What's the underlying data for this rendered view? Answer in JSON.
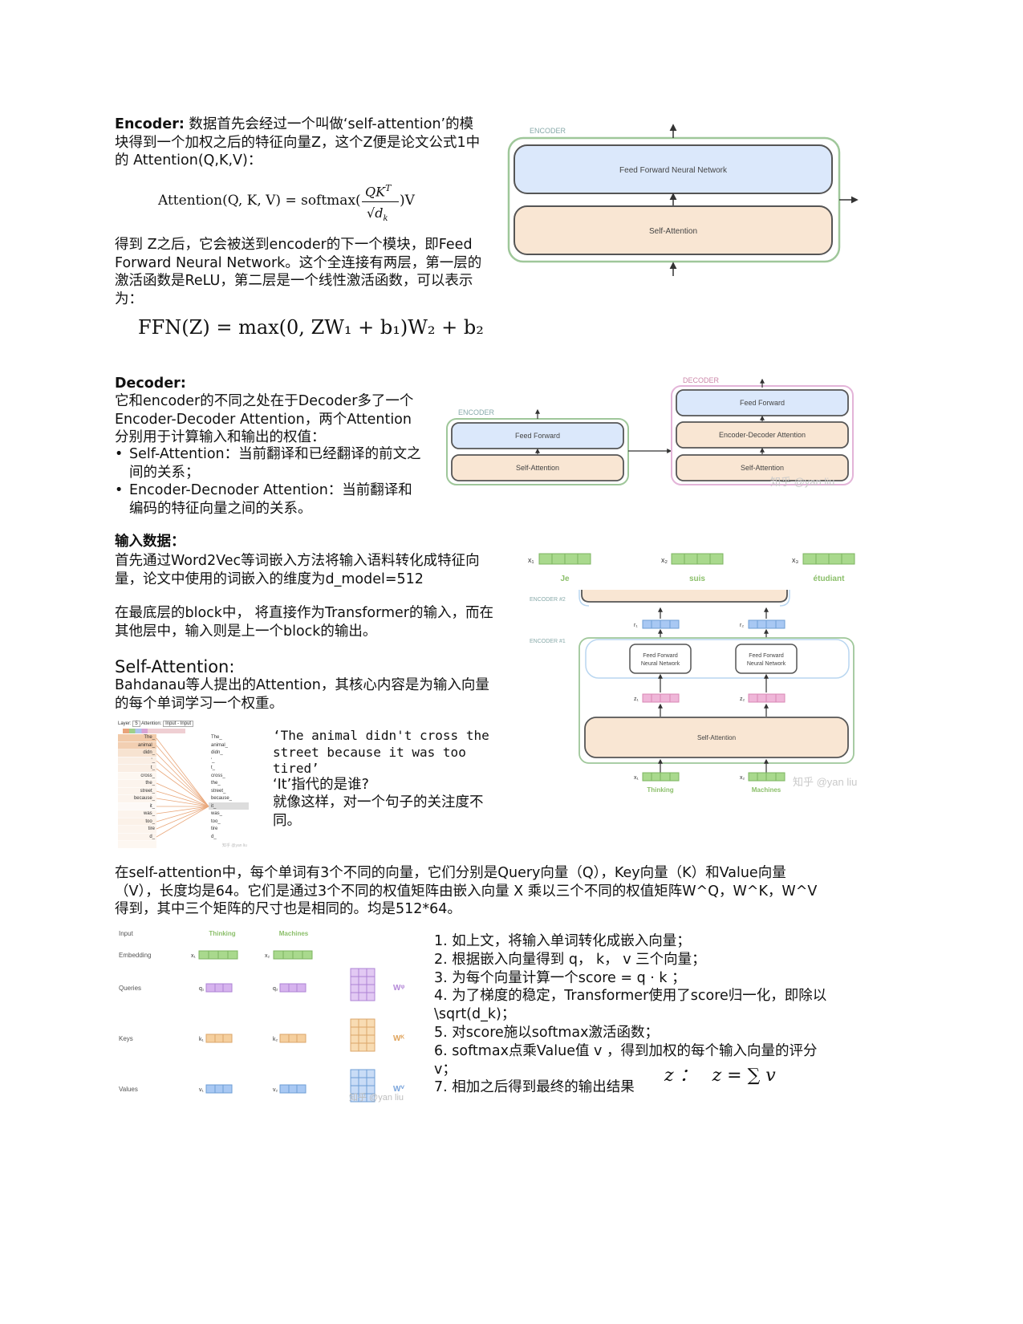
{
  "encoder": {
    "heading": "Encoder:",
    "intro": " 数据首先会经过一个叫做‘self-attention’的模块得到一个加权之后的特征向量Z，这个Z便是论文公式1中的 Attention(Q,K,V)：",
    "formula_lhs": "Attention(Q, K, V) = softmax(",
    "formula_num": "QK",
    "formula_sup": "T",
    "formula_den": "√d",
    "formula_den_sub": "k",
    "formula_rhs": ")V",
    "ffn_text": "得到 Z之后，它会被送到encoder的下一个模块，即Feed Forward Neural Network。这个全连接有两层，第一层的激活函数是ReLU，第二层是一个线性激活函数，可以表示为：",
    "ffn_formula": "FFN(Z) = max(0, ZW₁ + b₁)W₂ + b₂",
    "diagram": {
      "label": "ENCODER",
      "ffnn": "Feed Forward Neural Network",
      "self_attention": "Self-Attention"
    }
  },
  "decoder": {
    "heading": "Decoder:",
    "text": "它和encoder的不同之处在于Decoder多了一个Encoder-Decoder Attention，两个Attention分别用于计算输入和输出的权值：",
    "bullets": [
      "Self-Attention：当前翻译和已经翻译的前文之间的关系；",
      "Encoder-Decnoder Attention：当前翻译和编码的特征向量之间的关系。"
    ],
    "diagram": {
      "encoder_label": "ENCODER",
      "decoder_label": "DECODER",
      "feed_forward": "Feed Forward",
      "self_attention": "Self-Attention",
      "enc_dec_attention": "Encoder-Decoder Attention",
      "watermark": "知乎 @yan liu"
    }
  },
  "input": {
    "heading": "输入数据：",
    "p1": "首先通过Word2Vec等词嵌入方法将输入语料转化成特征向量，论文中使用的词嵌入的维度为d_model=512",
    "p2": "在最底层的block中，  将直接作为Transformer的输入，而在其他层中，输入则是上一个block的输出。",
    "diagram": {
      "x1": "x₁",
      "x2": "x₂",
      "x3": "x₃",
      "w1": "Je",
      "w2": "suis",
      "w3": "étudiant",
      "enc2": "ENCODER #2",
      "enc1": "ENCODER #1",
      "r1": "r₁",
      "r2": "r₂",
      "z1": "z₁",
      "z2": "z₂",
      "ffnn_line1": "Feed Forward",
      "ffnn_line2": "Neural Network",
      "self_attention": "Self-Attention",
      "bx1": "x₁",
      "bx2": "x₂",
      "thinking": "Thinking",
      "machines": "Machines",
      "watermark": "知乎 @yan liu"
    }
  },
  "selfattn": {
    "heading": "Self-Attention:",
    "text": "Bahdanau等人提出的Attention，其核心内容是为输入向量的每个单词学习一个权重。",
    "quote": "‘The animal didn't cross the street because it was too tired’",
    "q2": "‘It’指代的是谁?",
    "q3": "就像这样，对一个句子的关注度不同。",
    "viz": {
      "layer_label": "Layer:",
      "layer_value": "5",
      "attn_label": "Attention:",
      "attn_value": "Input - Input",
      "tokens": [
        "The_",
        "animal_",
        "didn_",
        "'_",
        "t_",
        "cross_",
        "the_",
        "street_",
        "because_",
        "it_",
        "was_",
        "too_",
        "tire",
        "d_"
      ],
      "footer": "知乎 @yan liu"
    }
  },
  "qkv": {
    "paragraph": "在self-attention中，每个单词有3个不同的向量，它们分别是Query向量（Q），Key向量（K）和Value向量（V），长度均是64。它们是通过3个不同的权值矩阵由嵌入向量 X 乘以三个不同的权值矩阵W^Q，W^K，W^V 得到，其中三个矩阵的尺寸也是相同的。均是512*64。",
    "diagram": {
      "input": "Input",
      "thinking": "Thinking",
      "machines": "Machines",
      "embedding": "Embedding",
      "queries": "Queries",
      "keys": "Keys",
      "values": "Values",
      "x1": "x₁",
      "x2": "x₂",
      "q1": "q₁",
      "q2": "q₂",
      "k1": "k₁",
      "k2": "k₂",
      "v1": "v₁",
      "v2": "v₂",
      "wq": "Wᵠ",
      "wk": "Wᴷ",
      "wv": "Wⱽ",
      "watermark": "知乎 @yan liu"
    },
    "steps": [
      "1.   如上文，将输入单词转化成嵌入向量；",
      "2. 根据嵌入向量得到  q， k， v 三个向量；",
      "3. 为每个向量计算一个score = q · k ；",
      "4. 为了梯度的稳定，Transformer使用了score归一化，即除以  \\sqrt(d_k)；",
      "5. 对score施以softmax激活函数；",
      "6. softmax点乘Value值 v ，得到加权的每个输入向量的评分 v；",
      "7. 相加之后得到最终的输出结果"
    ],
    "sum_label": "z ：",
    "sum_formula": "z = ∑ v"
  }
}
